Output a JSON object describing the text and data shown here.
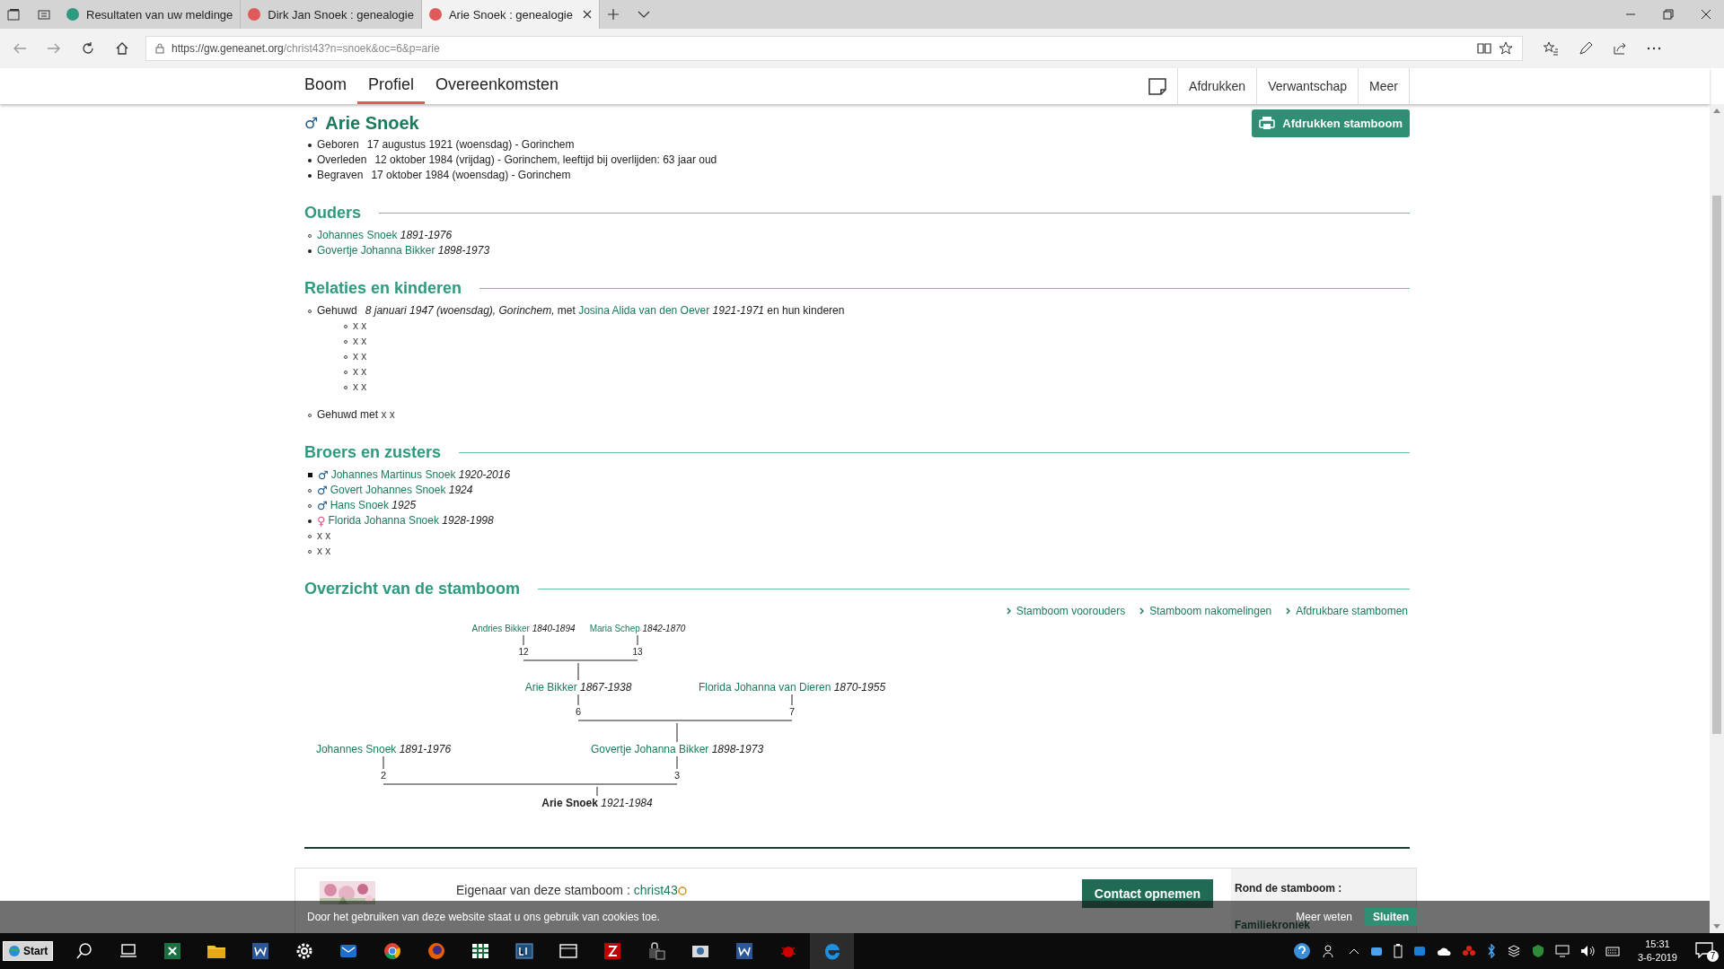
{
  "browser": {
    "tabs": [
      {
        "title": "Resultaten van uw meldinge",
        "selected": false,
        "color": "#2e9a7f"
      },
      {
        "title": "Dirk Jan Snoek : genealogie",
        "selected": false,
        "color": "#e05a5a"
      },
      {
        "title": "Arie Snoek : genealogie",
        "selected": true,
        "color": "#e05a5a"
      }
    ],
    "url_host": "https://gw.geneanet.org",
    "url_path": "/christ43?n=snoek&oc=6&p=arie"
  },
  "site_nav": {
    "tabs": [
      {
        "label": "Boom",
        "selected": false
      },
      {
        "label": "Profiel",
        "selected": true
      },
      {
        "label": "Overeenkomsten",
        "selected": false
      }
    ],
    "actions": [
      "Afdrukken",
      "Verwantschap",
      "Meer"
    ]
  },
  "person": {
    "symbol": "♂",
    "color": "#1e5a8a",
    "name": "Arie Snoek",
    "print_button": "Afdrukken stamboom",
    "facts": [
      {
        "label": "Geboren",
        "value": "17 augustus 1921 (woensdag) - Gorinchem"
      },
      {
        "label": "Overleden",
        "value": "12 oktober 1984 (vrijdag) - Gorinchem, leeftijd bij overlijden: 63 jaar oud"
      },
      {
        "label": "Begraven",
        "value": "17 oktober 1984 (woensdag) - Gorinchem"
      }
    ]
  },
  "parents": {
    "heading": "Ouders",
    "items": [
      {
        "bullet": {
          "kind": "circle"
        },
        "name": "Johannes Snoek",
        "years": "1891-1976"
      },
      {
        "bullet": {
          "kind": "disc"
        },
        "name": "Govertje Johanna Bikker",
        "years": "1898-1973"
      }
    ]
  },
  "relations": {
    "heading": "Relaties en kinderen",
    "marriages": [
      {
        "kind": "with_children",
        "label": "Gehuwd",
        "details": "8 januari 1947 (woensdag), Gorinchem,",
        "joiner": "met",
        "spouse": "Josina Alida van den Oever",
        "years": "1921-1971",
        "suffix": "en hun kinderen",
        "children": [
          "x x",
          "x x",
          "x x",
          "x x",
          "x x"
        ]
      },
      {
        "kind": "simple",
        "label": "Gehuwd met",
        "spouse": "x x"
      }
    ]
  },
  "siblings": {
    "heading": "Broers en zusters",
    "items": [
      {
        "kind": "person",
        "bullet": {
          "kind": "square"
        },
        "symbol": "♂",
        "color": "#1e5a8a",
        "name": "Johannes Martinus Snoek",
        "years": "1920-2016"
      },
      {
        "kind": "person",
        "bullet": {
          "kind": "circle"
        },
        "symbol": "♂",
        "color": "#1e5a8a",
        "name": "Govert Johannes Snoek",
        "years": "1924"
      },
      {
        "kind": "person",
        "bullet": {
          "kind": "circle"
        },
        "symbol": "♂",
        "color": "#1e5a8a",
        "name": "Hans Snoek",
        "years": "1925"
      },
      {
        "kind": "person",
        "bullet": {
          "kind": "disc"
        },
        "symbol": "♀",
        "color": "#e0508a",
        "name": "Florida Johanna Snoek",
        "years": "1928-1998"
      },
      {
        "kind": "unknown",
        "bullet": {
          "kind": "circle"
        },
        "name": "x x"
      },
      {
        "kind": "unknown",
        "bullet": {
          "kind": "circle"
        },
        "name": "x x"
      }
    ]
  },
  "tree": {
    "heading": "Overzicht van de stamboom",
    "links": [
      "Stamboom voorouders",
      "Stamboom nakomelingen",
      "Afdrukbare stambomen"
    ],
    "root": {
      "name": "Arie Snoek",
      "years": "1921-1984",
      "parents": [
        {
          "number": "2",
          "name": "Johannes Snoek",
          "years": "1891-1976"
        },
        {
          "number": "3",
          "name": "Govertje Johanna Bikker",
          "years": "1898-1973",
          "parents": [
            {
              "number": "6",
              "name": "Arie Bikker",
              "years": "1867-1938",
              "parents": [
                {
                  "number": "12",
                  "name": "Andries Bikker",
                  "years": "1840-1894"
                },
                {
                  "number": "13",
                  "name": "Maria Schep",
                  "years": "1842-1870"
                }
              ]
            },
            {
              "number": "7",
              "name": "Florida Johanna van Dieren",
              "years": "1870-1955"
            }
          ]
        }
      ]
    }
  },
  "footer": {
    "owner_label": "Eigenaar van deze stamboom :",
    "owner": "christ43",
    "contact_button": "Contact opnemen",
    "side_title": "Rond de stamboom :",
    "side_link": "Familiekroniek"
  },
  "cookie_bar": {
    "text": "Door het gebruiken van deze website staat u ons gebruik van cookies toe.",
    "more": "Meer weten",
    "close": "Sluiten"
  },
  "taskbar": {
    "start": "Start",
    "time": "15:31",
    "date": "3-6-2019",
    "notifications": "7"
  }
}
